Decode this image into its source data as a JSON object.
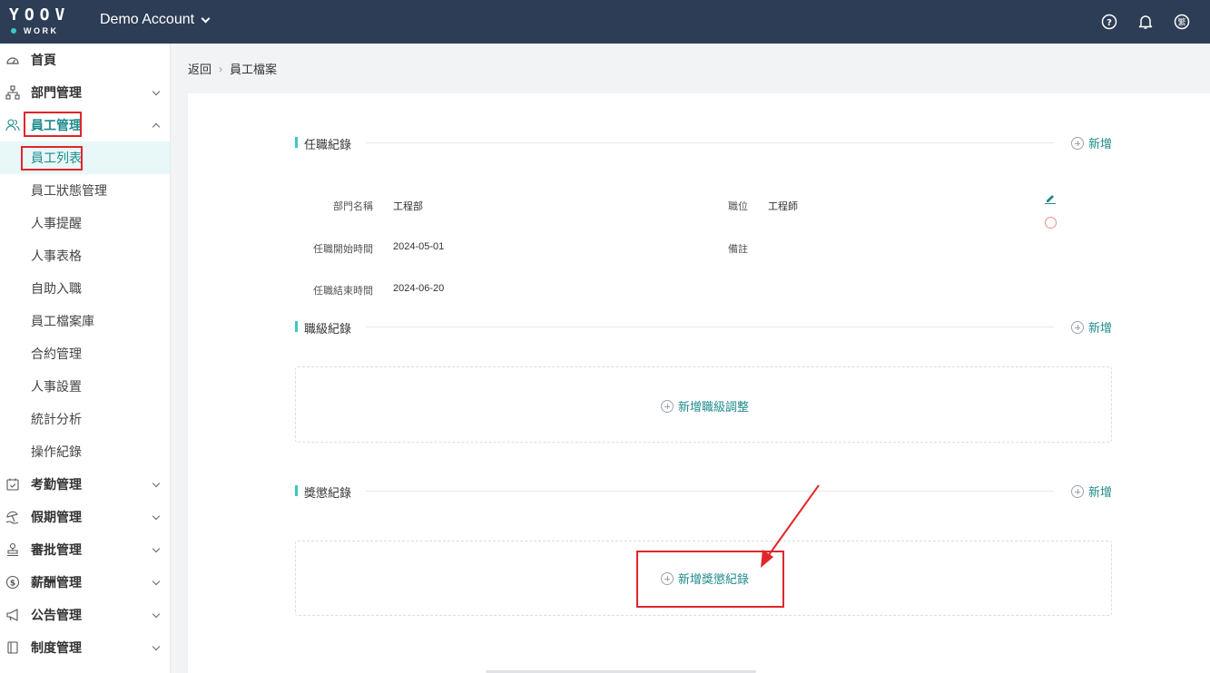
{
  "header": {
    "logo_top": "YOOV",
    "logo_bottom": "WORK",
    "account": "Demo Account",
    "icons": [
      "help-icon",
      "bell-icon",
      "language-icon"
    ],
    "lang_label": "繁"
  },
  "sidebar": {
    "items": [
      {
        "label": "首頁",
        "icon": "dashboard-icon"
      },
      {
        "label": "部門管理",
        "icon": "org-chart-icon"
      },
      {
        "label": "員工管理",
        "icon": "users-icon"
      },
      {
        "label": "員工列表"
      },
      {
        "label": "員工狀態管理"
      },
      {
        "label": "人事提醒"
      },
      {
        "label": "人事表格"
      },
      {
        "label": "自助入職"
      },
      {
        "label": "員工檔案庫"
      },
      {
        "label": "合約管理"
      },
      {
        "label": "人事設置"
      },
      {
        "label": "統計分析"
      },
      {
        "label": "操作紀錄"
      },
      {
        "label": "考勤管理",
        "icon": "calendar-check-icon"
      },
      {
        "label": "假期管理",
        "icon": "beach-icon"
      },
      {
        "label": "審批管理",
        "icon": "stamp-icon"
      },
      {
        "label": "薪酬管理",
        "icon": "dollar-icon"
      },
      {
        "label": "公告管理",
        "icon": "megaphone-icon"
      },
      {
        "label": "制度管理",
        "icon": "book-icon"
      }
    ]
  },
  "breadcrumb": {
    "back": "返回",
    "separator": "›",
    "current": "員工檔案"
  },
  "sections": {
    "employment": {
      "title": "任職紀錄",
      "add": "新增",
      "fields": {
        "dept_label": "部門名稱",
        "dept_value": "工程部",
        "position_label": "職位",
        "position_value": "工程師",
        "start_label": "任職開始時間",
        "start_value": "2024-05-01",
        "remark_label": "備註",
        "remark_value": "",
        "end_label": "任職結束時間",
        "end_value": "2024-06-20"
      }
    },
    "rank": {
      "title": "職級紀錄",
      "add": "新增",
      "box_add": "新增職級調整"
    },
    "reward": {
      "title": "獎懲紀錄",
      "add": "新增",
      "box_add": "新增獎懲紀錄"
    }
  },
  "colors": {
    "topbar": "#2d3d55",
    "accent": "#3dc6c7",
    "link": "#1f8b8c",
    "highlight": "#e0262b"
  }
}
